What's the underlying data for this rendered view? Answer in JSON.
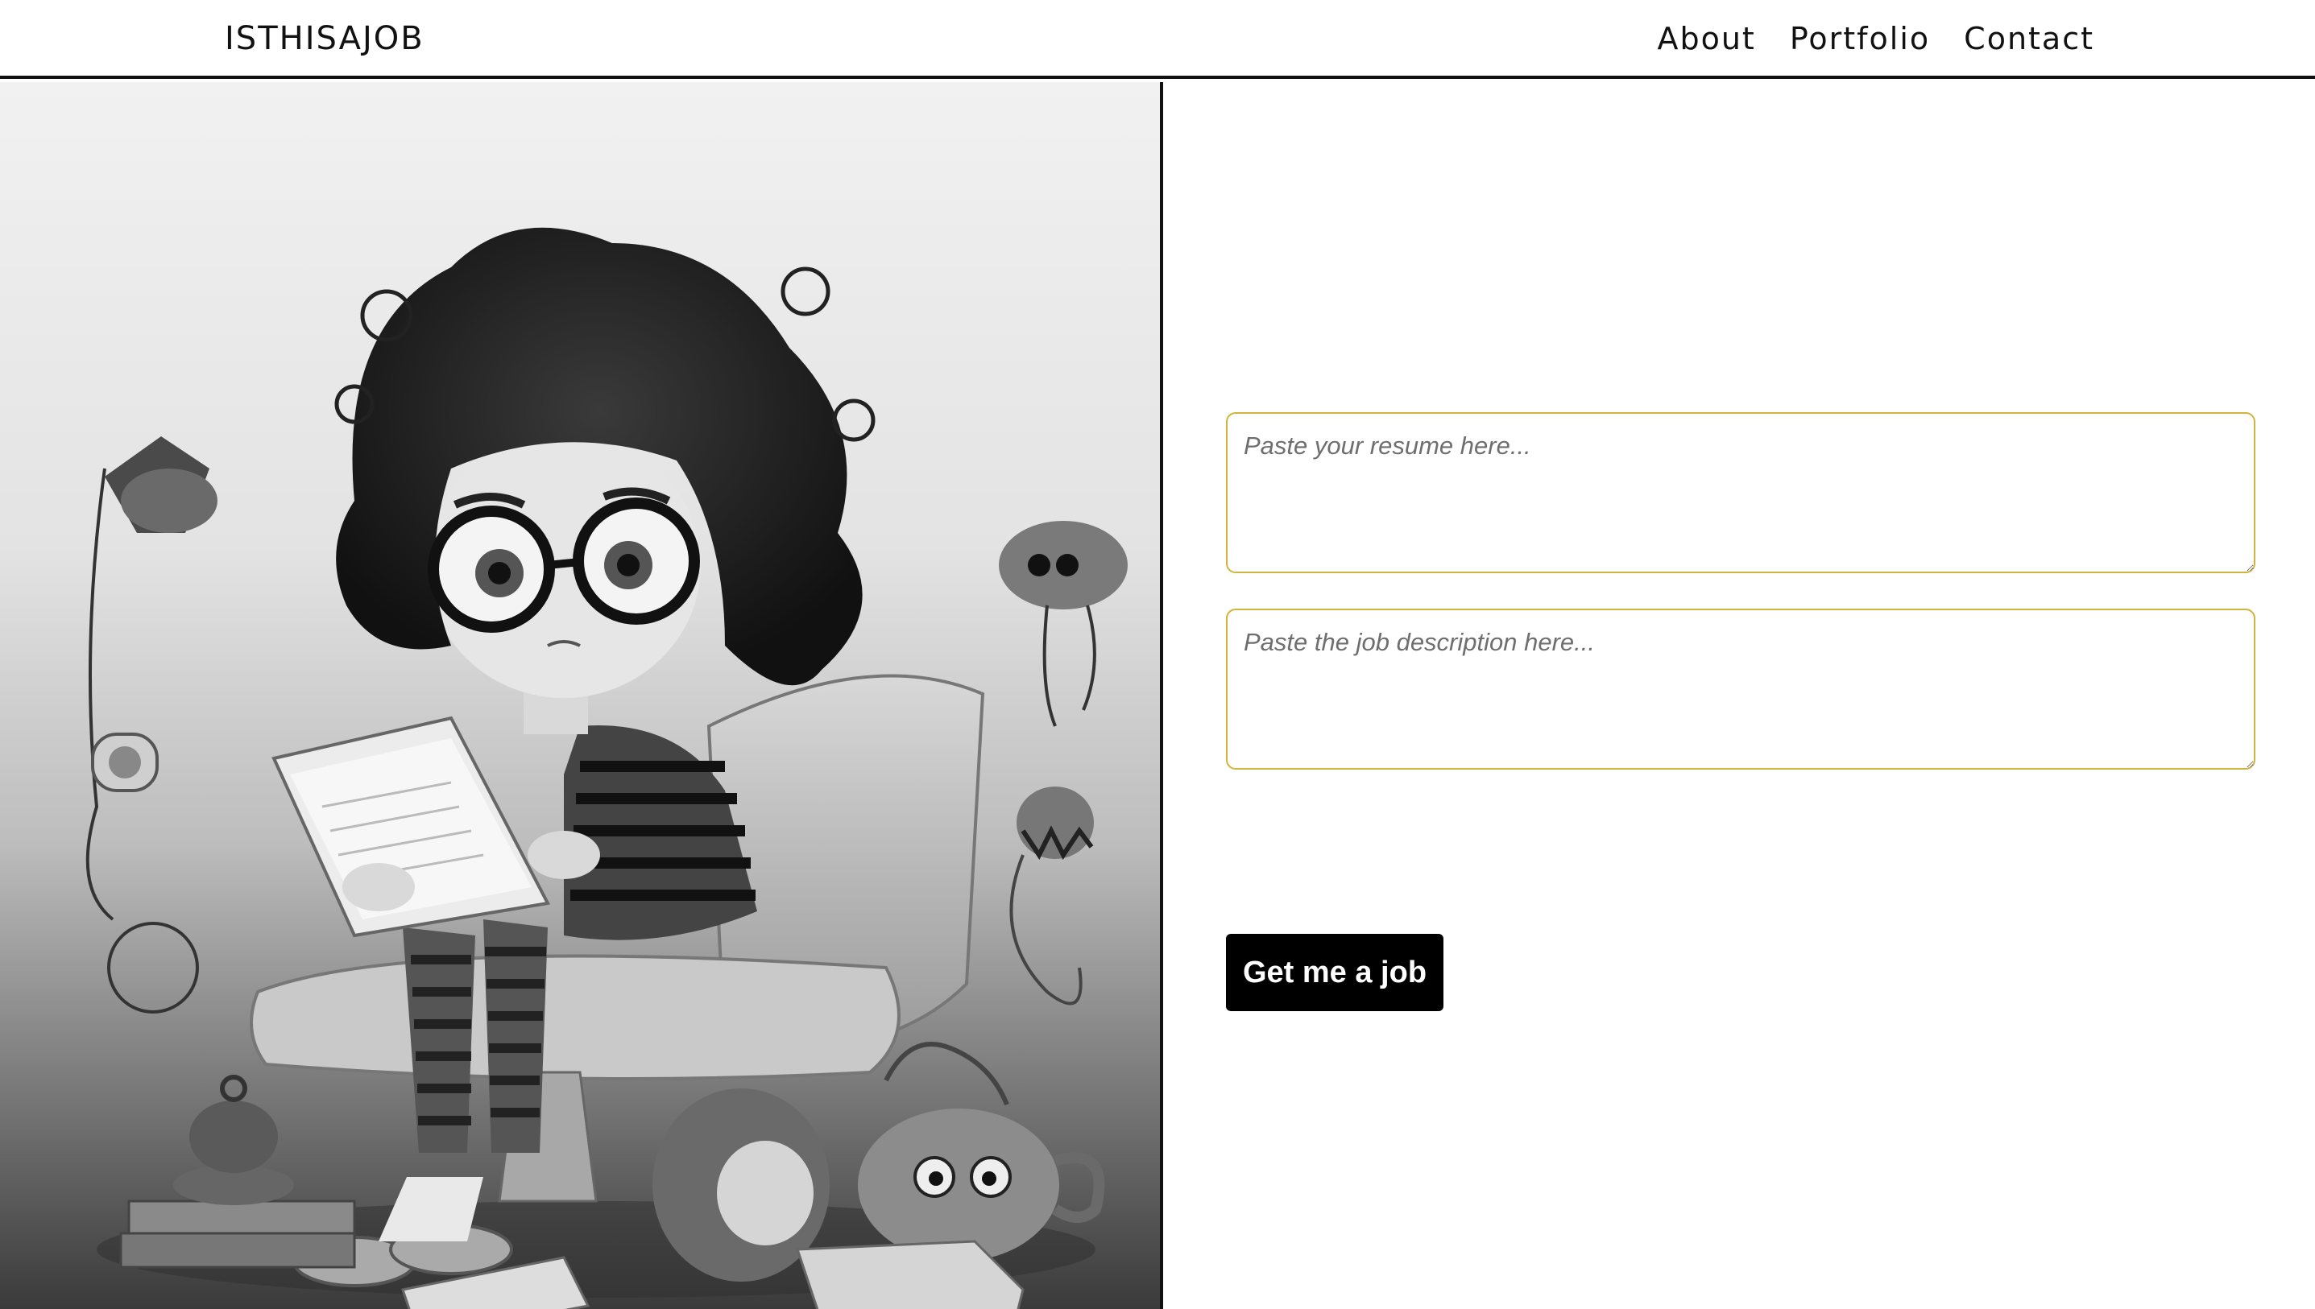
{
  "header": {
    "brand": "ISTHISAJOB",
    "nav": [
      {
        "label": "About"
      },
      {
        "label": "Portfolio"
      },
      {
        "label": "Contact"
      }
    ]
  },
  "form": {
    "resume_placeholder": "Paste your resume here...",
    "job_placeholder": "Paste the job description here...",
    "submit_label": "Get me a job"
  },
  "colors": {
    "accent_border": "#d2b33e",
    "button_bg": "#000000",
    "button_text": "#ffffff"
  }
}
